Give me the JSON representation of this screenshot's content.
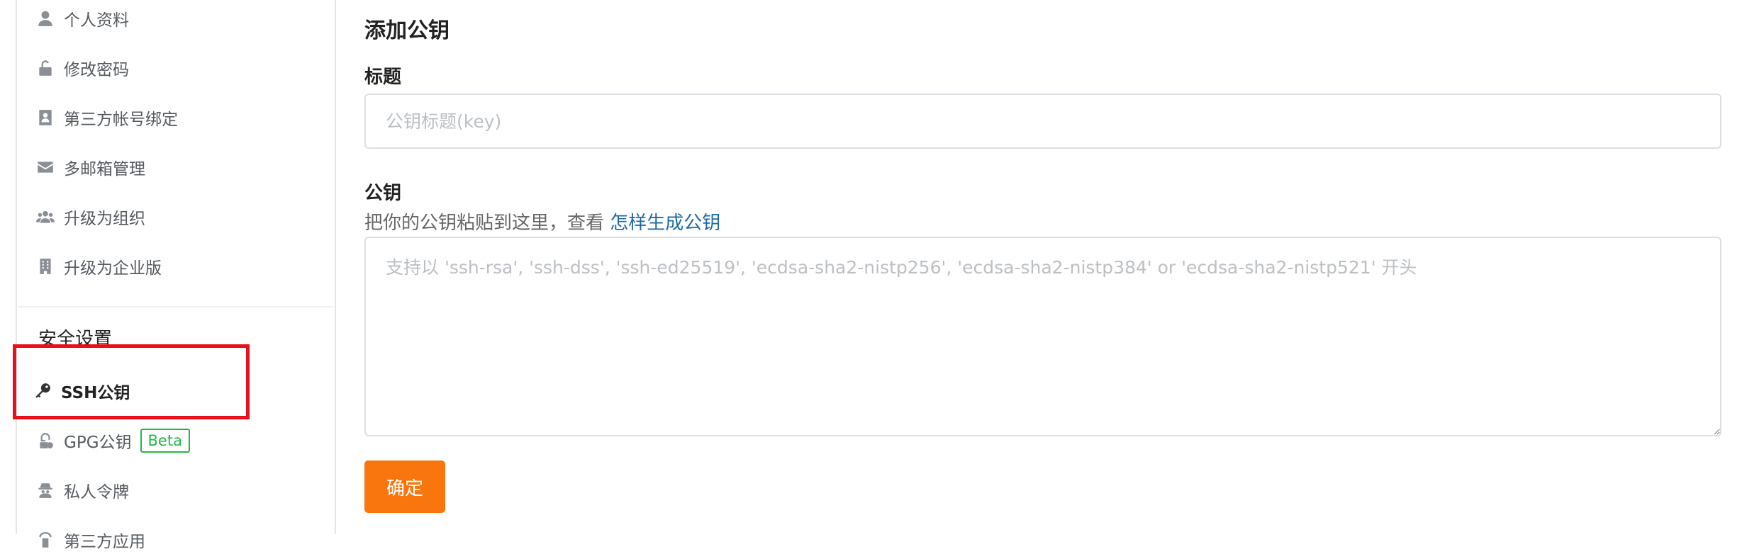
{
  "sidebar": {
    "items": [
      {
        "label": "个人资料",
        "icon": "user-icon"
      },
      {
        "label": "修改密码",
        "icon": "unlock-icon"
      },
      {
        "label": "第三方帐号绑定",
        "icon": "contact-card-icon"
      },
      {
        "label": "多邮箱管理",
        "icon": "envelope-icon"
      },
      {
        "label": "升级为组织",
        "icon": "users-icon"
      },
      {
        "label": "升级为企业版",
        "icon": "building-icon"
      }
    ],
    "section_title": "安全设置",
    "security_items": [
      {
        "label": "SSH公钥",
        "icon": "key-icon",
        "active": true
      },
      {
        "label": "GPG公钥",
        "icon": "gpg-key-icon",
        "badge": "Beta"
      },
      {
        "label": "私人令牌",
        "icon": "user-secret-icon"
      },
      {
        "label": "第三方应用",
        "icon": "app-icon"
      }
    ],
    "highlight_color": "#e8101a",
    "badge_color": "#21ba45"
  },
  "form": {
    "title": "添加公钥",
    "title_label": "标题",
    "title_placeholder": "公钥标题(key)",
    "title_value": "",
    "key_label": "公钥",
    "help_text": "把你的公钥粘贴到这里，查看 ",
    "help_link": "怎样生成公钥",
    "key_placeholder": "支持以 'ssh-rsa', 'ssh-dss', 'ssh-ed25519', 'ecdsa-sha2-nistp256', 'ecdsa-sha2-nistp384' or 'ecdsa-sha2-nistp521' 开头",
    "key_value": "",
    "submit_label": "确定",
    "submit_color": "#f8760d",
    "link_color": "#1d6aa5"
  }
}
